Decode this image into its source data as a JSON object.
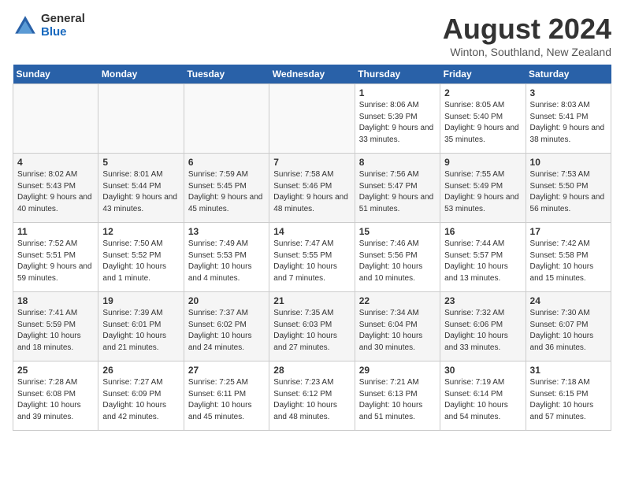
{
  "header": {
    "logo_general": "General",
    "logo_blue": "Blue",
    "title": "August 2024",
    "subtitle": "Winton, Southland, New Zealand"
  },
  "days_of_week": [
    "Sunday",
    "Monday",
    "Tuesday",
    "Wednesday",
    "Thursday",
    "Friday",
    "Saturday"
  ],
  "weeks": [
    [
      {
        "day": "",
        "sunrise": "",
        "sunset": "",
        "daylight": "",
        "empty": true
      },
      {
        "day": "",
        "sunrise": "",
        "sunset": "",
        "daylight": "",
        "empty": true
      },
      {
        "day": "",
        "sunrise": "",
        "sunset": "",
        "daylight": "",
        "empty": true
      },
      {
        "day": "",
        "sunrise": "",
        "sunset": "",
        "daylight": "",
        "empty": true
      },
      {
        "day": "1",
        "sunrise": "Sunrise: 8:06 AM",
        "sunset": "Sunset: 5:39 PM",
        "daylight": "Daylight: 9 hours and 33 minutes.",
        "empty": false
      },
      {
        "day": "2",
        "sunrise": "Sunrise: 8:05 AM",
        "sunset": "Sunset: 5:40 PM",
        "daylight": "Daylight: 9 hours and 35 minutes.",
        "empty": false
      },
      {
        "day": "3",
        "sunrise": "Sunrise: 8:03 AM",
        "sunset": "Sunset: 5:41 PM",
        "daylight": "Daylight: 9 hours and 38 minutes.",
        "empty": false
      }
    ],
    [
      {
        "day": "4",
        "sunrise": "Sunrise: 8:02 AM",
        "sunset": "Sunset: 5:43 PM",
        "daylight": "Daylight: 9 hours and 40 minutes.",
        "empty": false
      },
      {
        "day": "5",
        "sunrise": "Sunrise: 8:01 AM",
        "sunset": "Sunset: 5:44 PM",
        "daylight": "Daylight: 9 hours and 43 minutes.",
        "empty": false
      },
      {
        "day": "6",
        "sunrise": "Sunrise: 7:59 AM",
        "sunset": "Sunset: 5:45 PM",
        "daylight": "Daylight: 9 hours and 45 minutes.",
        "empty": false
      },
      {
        "day": "7",
        "sunrise": "Sunrise: 7:58 AM",
        "sunset": "Sunset: 5:46 PM",
        "daylight": "Daylight: 9 hours and 48 minutes.",
        "empty": false
      },
      {
        "day": "8",
        "sunrise": "Sunrise: 7:56 AM",
        "sunset": "Sunset: 5:47 PM",
        "daylight": "Daylight: 9 hours and 51 minutes.",
        "empty": false
      },
      {
        "day": "9",
        "sunrise": "Sunrise: 7:55 AM",
        "sunset": "Sunset: 5:49 PM",
        "daylight": "Daylight: 9 hours and 53 minutes.",
        "empty": false
      },
      {
        "day": "10",
        "sunrise": "Sunrise: 7:53 AM",
        "sunset": "Sunset: 5:50 PM",
        "daylight": "Daylight: 9 hours and 56 minutes.",
        "empty": false
      }
    ],
    [
      {
        "day": "11",
        "sunrise": "Sunrise: 7:52 AM",
        "sunset": "Sunset: 5:51 PM",
        "daylight": "Daylight: 9 hours and 59 minutes.",
        "empty": false
      },
      {
        "day": "12",
        "sunrise": "Sunrise: 7:50 AM",
        "sunset": "Sunset: 5:52 PM",
        "daylight": "Daylight: 10 hours and 1 minute.",
        "empty": false
      },
      {
        "day": "13",
        "sunrise": "Sunrise: 7:49 AM",
        "sunset": "Sunset: 5:53 PM",
        "daylight": "Daylight: 10 hours and 4 minutes.",
        "empty": false
      },
      {
        "day": "14",
        "sunrise": "Sunrise: 7:47 AM",
        "sunset": "Sunset: 5:55 PM",
        "daylight": "Daylight: 10 hours and 7 minutes.",
        "empty": false
      },
      {
        "day": "15",
        "sunrise": "Sunrise: 7:46 AM",
        "sunset": "Sunset: 5:56 PM",
        "daylight": "Daylight: 10 hours and 10 minutes.",
        "empty": false
      },
      {
        "day": "16",
        "sunrise": "Sunrise: 7:44 AM",
        "sunset": "Sunset: 5:57 PM",
        "daylight": "Daylight: 10 hours and 13 minutes.",
        "empty": false
      },
      {
        "day": "17",
        "sunrise": "Sunrise: 7:42 AM",
        "sunset": "Sunset: 5:58 PM",
        "daylight": "Daylight: 10 hours and 15 minutes.",
        "empty": false
      }
    ],
    [
      {
        "day": "18",
        "sunrise": "Sunrise: 7:41 AM",
        "sunset": "Sunset: 5:59 PM",
        "daylight": "Daylight: 10 hours and 18 minutes.",
        "empty": false
      },
      {
        "day": "19",
        "sunrise": "Sunrise: 7:39 AM",
        "sunset": "Sunset: 6:01 PM",
        "daylight": "Daylight: 10 hours and 21 minutes.",
        "empty": false
      },
      {
        "day": "20",
        "sunrise": "Sunrise: 7:37 AM",
        "sunset": "Sunset: 6:02 PM",
        "daylight": "Daylight: 10 hours and 24 minutes.",
        "empty": false
      },
      {
        "day": "21",
        "sunrise": "Sunrise: 7:35 AM",
        "sunset": "Sunset: 6:03 PM",
        "daylight": "Daylight: 10 hours and 27 minutes.",
        "empty": false
      },
      {
        "day": "22",
        "sunrise": "Sunrise: 7:34 AM",
        "sunset": "Sunset: 6:04 PM",
        "daylight": "Daylight: 10 hours and 30 minutes.",
        "empty": false
      },
      {
        "day": "23",
        "sunrise": "Sunrise: 7:32 AM",
        "sunset": "Sunset: 6:06 PM",
        "daylight": "Daylight: 10 hours and 33 minutes.",
        "empty": false
      },
      {
        "day": "24",
        "sunrise": "Sunrise: 7:30 AM",
        "sunset": "Sunset: 6:07 PM",
        "daylight": "Daylight: 10 hours and 36 minutes.",
        "empty": false
      }
    ],
    [
      {
        "day": "25",
        "sunrise": "Sunrise: 7:28 AM",
        "sunset": "Sunset: 6:08 PM",
        "daylight": "Daylight: 10 hours and 39 minutes.",
        "empty": false
      },
      {
        "day": "26",
        "sunrise": "Sunrise: 7:27 AM",
        "sunset": "Sunset: 6:09 PM",
        "daylight": "Daylight: 10 hours and 42 minutes.",
        "empty": false
      },
      {
        "day": "27",
        "sunrise": "Sunrise: 7:25 AM",
        "sunset": "Sunset: 6:11 PM",
        "daylight": "Daylight: 10 hours and 45 minutes.",
        "empty": false
      },
      {
        "day": "28",
        "sunrise": "Sunrise: 7:23 AM",
        "sunset": "Sunset: 6:12 PM",
        "daylight": "Daylight: 10 hours and 48 minutes.",
        "empty": false
      },
      {
        "day": "29",
        "sunrise": "Sunrise: 7:21 AM",
        "sunset": "Sunset: 6:13 PM",
        "daylight": "Daylight: 10 hours and 51 minutes.",
        "empty": false
      },
      {
        "day": "30",
        "sunrise": "Sunrise: 7:19 AM",
        "sunset": "Sunset: 6:14 PM",
        "daylight": "Daylight: 10 hours and 54 minutes.",
        "empty": false
      },
      {
        "day": "31",
        "sunrise": "Sunrise: 7:18 AM",
        "sunset": "Sunset: 6:15 PM",
        "daylight": "Daylight: 10 hours and 57 minutes.",
        "empty": false
      }
    ]
  ]
}
